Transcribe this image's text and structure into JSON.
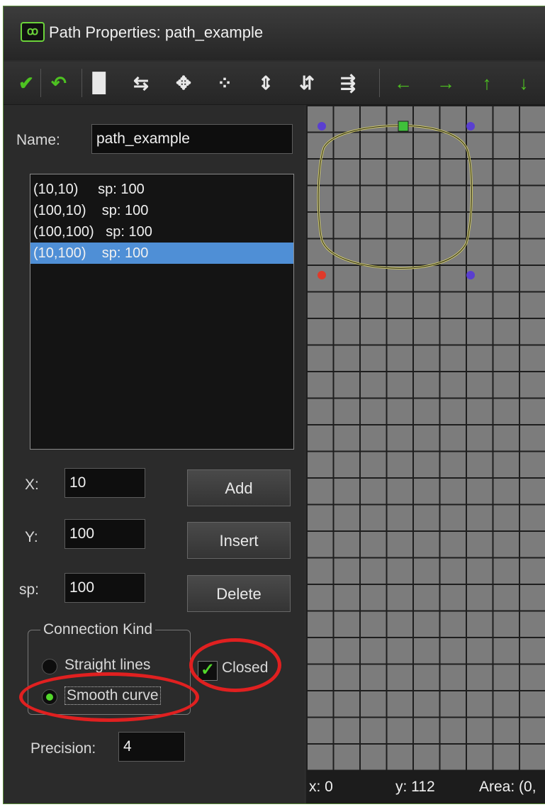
{
  "window": {
    "title": "Path Properties: path_example",
    "logo_text": "ꝏ"
  },
  "toolbar": {
    "icons": [
      {
        "name": "ok-check-icon",
        "glyph": "✔",
        "tone": "green"
      },
      {
        "name": "undo-icon",
        "glyph": "↶",
        "tone": "green"
      },
      {
        "name": "new-page-icon",
        "glyph": "▉",
        "tone": "white"
      },
      {
        "name": "reverse-path-icon",
        "glyph": "⇆",
        "tone": "white"
      },
      {
        "name": "move-path-icon",
        "glyph": "✥",
        "tone": "white"
      },
      {
        "name": "mirror-horizontal-icon",
        "glyph": "⁘",
        "tone": "white"
      },
      {
        "name": "flip-vertical-icon",
        "glyph": "⇕",
        "tone": "white"
      },
      {
        "name": "rotate-path-icon",
        "glyph": "⇵",
        "tone": "white"
      },
      {
        "name": "scale-path-icon",
        "glyph": "⇶",
        "tone": "white"
      },
      {
        "name": "shift-left-icon",
        "glyph": "←",
        "tone": "green"
      },
      {
        "name": "shift-right-icon",
        "glyph": "→",
        "tone": "green"
      },
      {
        "name": "shift-up-icon",
        "glyph": "↑",
        "tone": "green"
      },
      {
        "name": "shift-down-icon",
        "glyph": "↓",
        "tone": "green"
      }
    ]
  },
  "properties": {
    "name_label": "Name:",
    "name_value": "path_example",
    "points": [
      {
        "text": "(10,10)     sp: 100",
        "selected": false
      },
      {
        "text": "(100,10)    sp: 100",
        "selected": false
      },
      {
        "text": "(100,100)   sp: 100",
        "selected": false
      },
      {
        "text": "(10,100)    sp: 100",
        "selected": true
      }
    ],
    "x_label": "X:",
    "x_value": "10",
    "y_label": "Y:",
    "y_value": "100",
    "sp_label": "sp:",
    "sp_value": "100",
    "add_label": "Add",
    "insert_label": "Insert",
    "delete_label": "Delete",
    "connection_kind_label": "Connection Kind",
    "straight_label": "Straight lines",
    "smooth_label": "Smooth curve",
    "closed_label": "Closed",
    "closed_checked": true,
    "smooth_selected": true,
    "precision_label": "Precision:",
    "precision_value": "4"
  },
  "status": {
    "x": "x: 0",
    "y": "y: 112",
    "area": "Area: (0,"
  },
  "colors": {
    "accent_green": "#4dc221",
    "selection_blue": "#4f8fd6",
    "highlight_red": "#e02020",
    "path_yellow": "#d9d36a",
    "point_purple": "#5a3fd0",
    "point_red": "#e03a2a"
  }
}
